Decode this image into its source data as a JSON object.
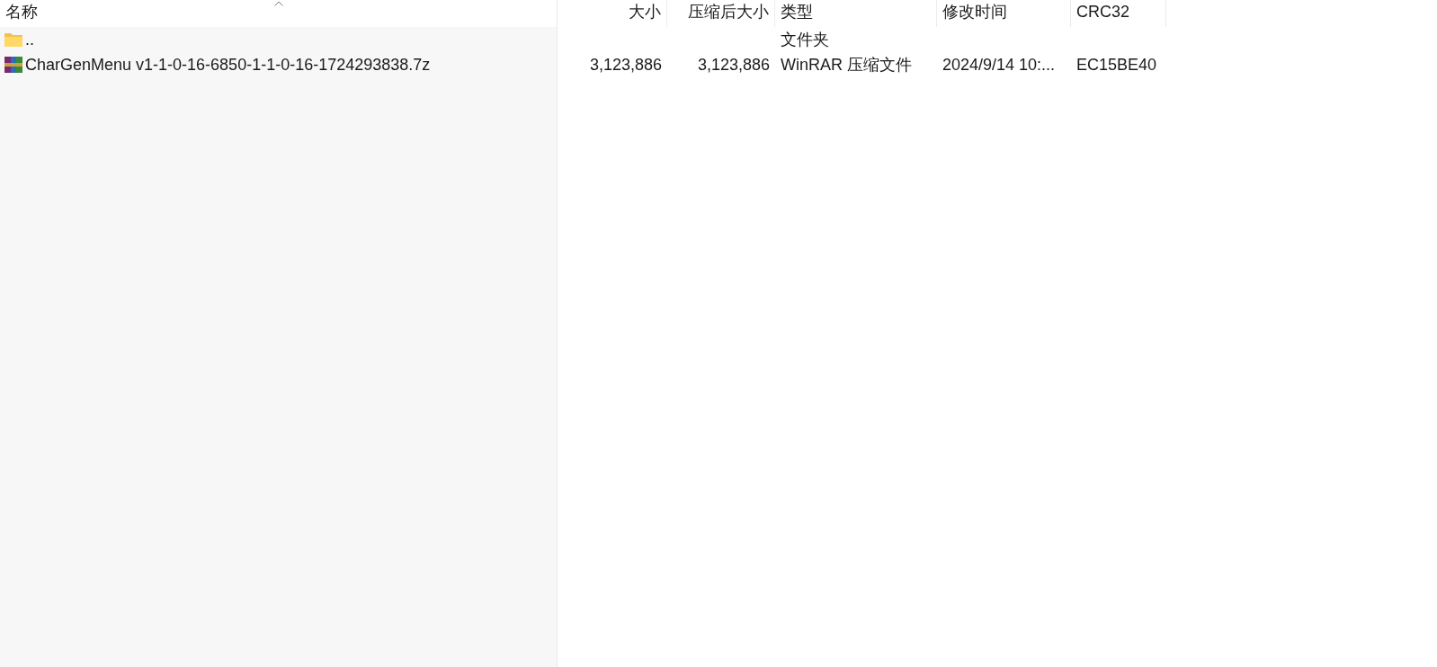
{
  "table": {
    "columns": [
      {
        "label": "名称",
        "sorted": true
      },
      {
        "label": "大小",
        "sorted": false
      },
      {
        "label": "压缩后大小",
        "sorted": false
      },
      {
        "label": "类型",
        "sorted": false
      },
      {
        "label": "修改时间",
        "sorted": false
      },
      {
        "label": "CRC32",
        "sorted": false
      }
    ],
    "rows": [
      {
        "kind": "folder",
        "cells": [
          "..",
          "",
          "",
          "文件夹",
          "",
          ""
        ]
      },
      {
        "kind": "archive",
        "cells": [
          "CharGenMenu v1-1-0-16-6850-1-1-0-16-1724293838.7z",
          "3,123,886",
          "3,123,886",
          "WinRAR 压缩文件",
          "2024/9/14 10:...",
          "EC15BE40"
        ]
      }
    ]
  }
}
